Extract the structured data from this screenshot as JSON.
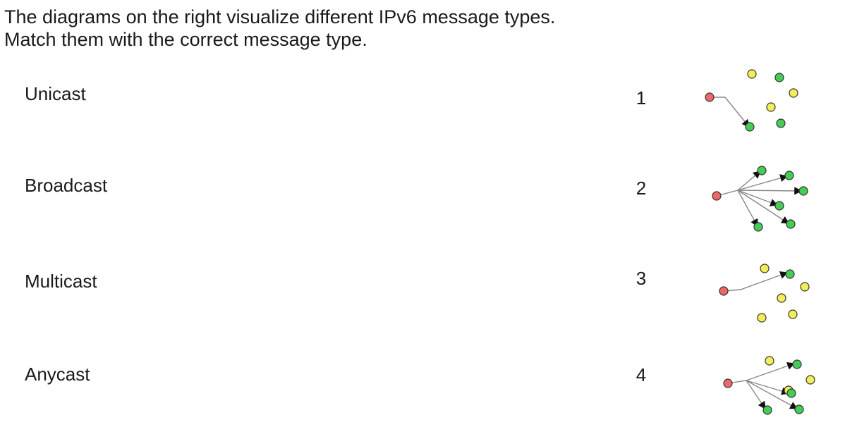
{
  "instructions": {
    "line1": "The diagrams on the right visualize different IPv6 message types.",
    "line2": "Match them with the correct message type."
  },
  "terms": [
    "Unicast",
    "Broadcast",
    "Multicast",
    "Anycast"
  ],
  "diagram_numbers": [
    "1",
    "2",
    "3",
    "4"
  ],
  "colors": {
    "source": "#ee6666",
    "receiver": "#44cc55",
    "non_receiver": "#f2ee55"
  },
  "diagrams": [
    {
      "receivers_highlighted": 1,
      "nodes_total": 7
    },
    {
      "receivers_highlighted": 6,
      "nodes_total": 7
    },
    {
      "receivers_highlighted": 1,
      "nodes_total": 7
    },
    {
      "receivers_highlighted": 4,
      "nodes_total": 8
    }
  ]
}
